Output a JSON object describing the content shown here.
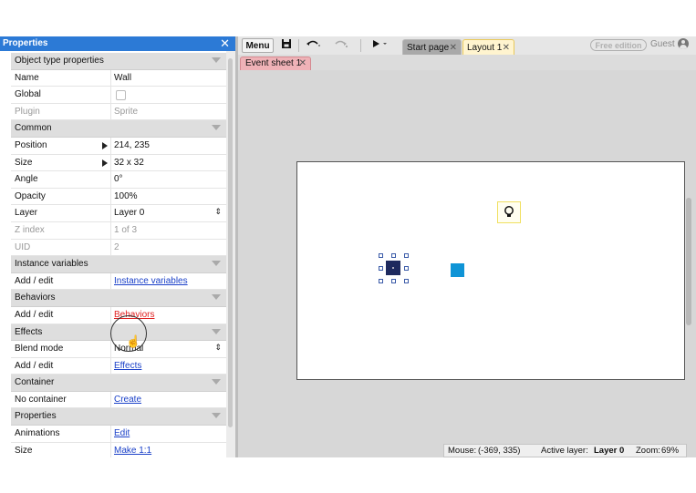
{
  "properties": {
    "title": "Properties",
    "close_glyph": "✕",
    "rows": [
      {
        "type": "section",
        "label": "Object type properties"
      },
      {
        "type": "text",
        "label": "Name",
        "value": "Wall"
      },
      {
        "type": "checkbox",
        "label": "Global",
        "checked": false
      },
      {
        "type": "text",
        "label": "Plugin",
        "value": "Sprite",
        "dim": true
      },
      {
        "type": "section",
        "label": "Common"
      },
      {
        "type": "expand",
        "label": "Position",
        "value": "214, 235"
      },
      {
        "type": "expand",
        "label": "Size",
        "value": "32 x 32"
      },
      {
        "type": "text",
        "label": "Angle",
        "value": "0°"
      },
      {
        "type": "text",
        "label": "Opacity",
        "value": "100%"
      },
      {
        "type": "select",
        "label": "Layer",
        "value": "Layer 0"
      },
      {
        "type": "text",
        "label": "Z index",
        "value": "1 of 3",
        "dim": true
      },
      {
        "type": "text",
        "label": "UID",
        "value": "2",
        "dim": true
      },
      {
        "type": "section",
        "label": "Instance variables"
      },
      {
        "type": "link",
        "label": "Add / edit",
        "value": "Instance variables"
      },
      {
        "type": "section",
        "label": "Behaviors"
      },
      {
        "type": "link",
        "label": "Add / edit",
        "value": "Behaviors",
        "active": true
      },
      {
        "type": "section",
        "label": "Effects"
      },
      {
        "type": "select",
        "label": "Blend mode",
        "value": "Normal"
      },
      {
        "type": "link",
        "label": "Add / edit",
        "value": "Effects"
      },
      {
        "type": "section",
        "label": "Container"
      },
      {
        "type": "link",
        "label": "No container",
        "value": "Create"
      },
      {
        "type": "section",
        "label": "Properties"
      },
      {
        "type": "link",
        "label": "Animations",
        "value": "Edit"
      },
      {
        "type": "link",
        "label": "Size",
        "value": "Make 1:1"
      }
    ]
  },
  "toolbar": {
    "menu_label": "Menu",
    "tabs": [
      {
        "label": "Start page",
        "close": "✕"
      },
      {
        "label": "Layout 1",
        "close": "✕"
      }
    ],
    "free_badge": "Free edition",
    "guest_label": "Guest"
  },
  "subtabs": {
    "event_sheet_label": "Event sheet 1",
    "close": "✕"
  },
  "status_bar": {
    "mouse_label": "Mouse:",
    "mouse_value": "(-369, 335)",
    "layer_label": "Active layer:",
    "layer_value": "Layer 0",
    "zoom_label": "Zoom:",
    "zoom_value": "69%"
  },
  "colors": {
    "header_blue": "#2c7ad6",
    "wall_sprite": "#1e2a5e",
    "blue_sprite": "#0f94d6",
    "link": "#1a40c8",
    "link_active": "#e02020",
    "event_tab": "#efb2b7",
    "layout_tab": "#fff4cf"
  },
  "icons": [
    "save-icon",
    "undo-icon",
    "redo-icon",
    "play-icon",
    "close-icon",
    "user-icon",
    "lightbulb-icon",
    "hand-cursor-icon"
  ]
}
